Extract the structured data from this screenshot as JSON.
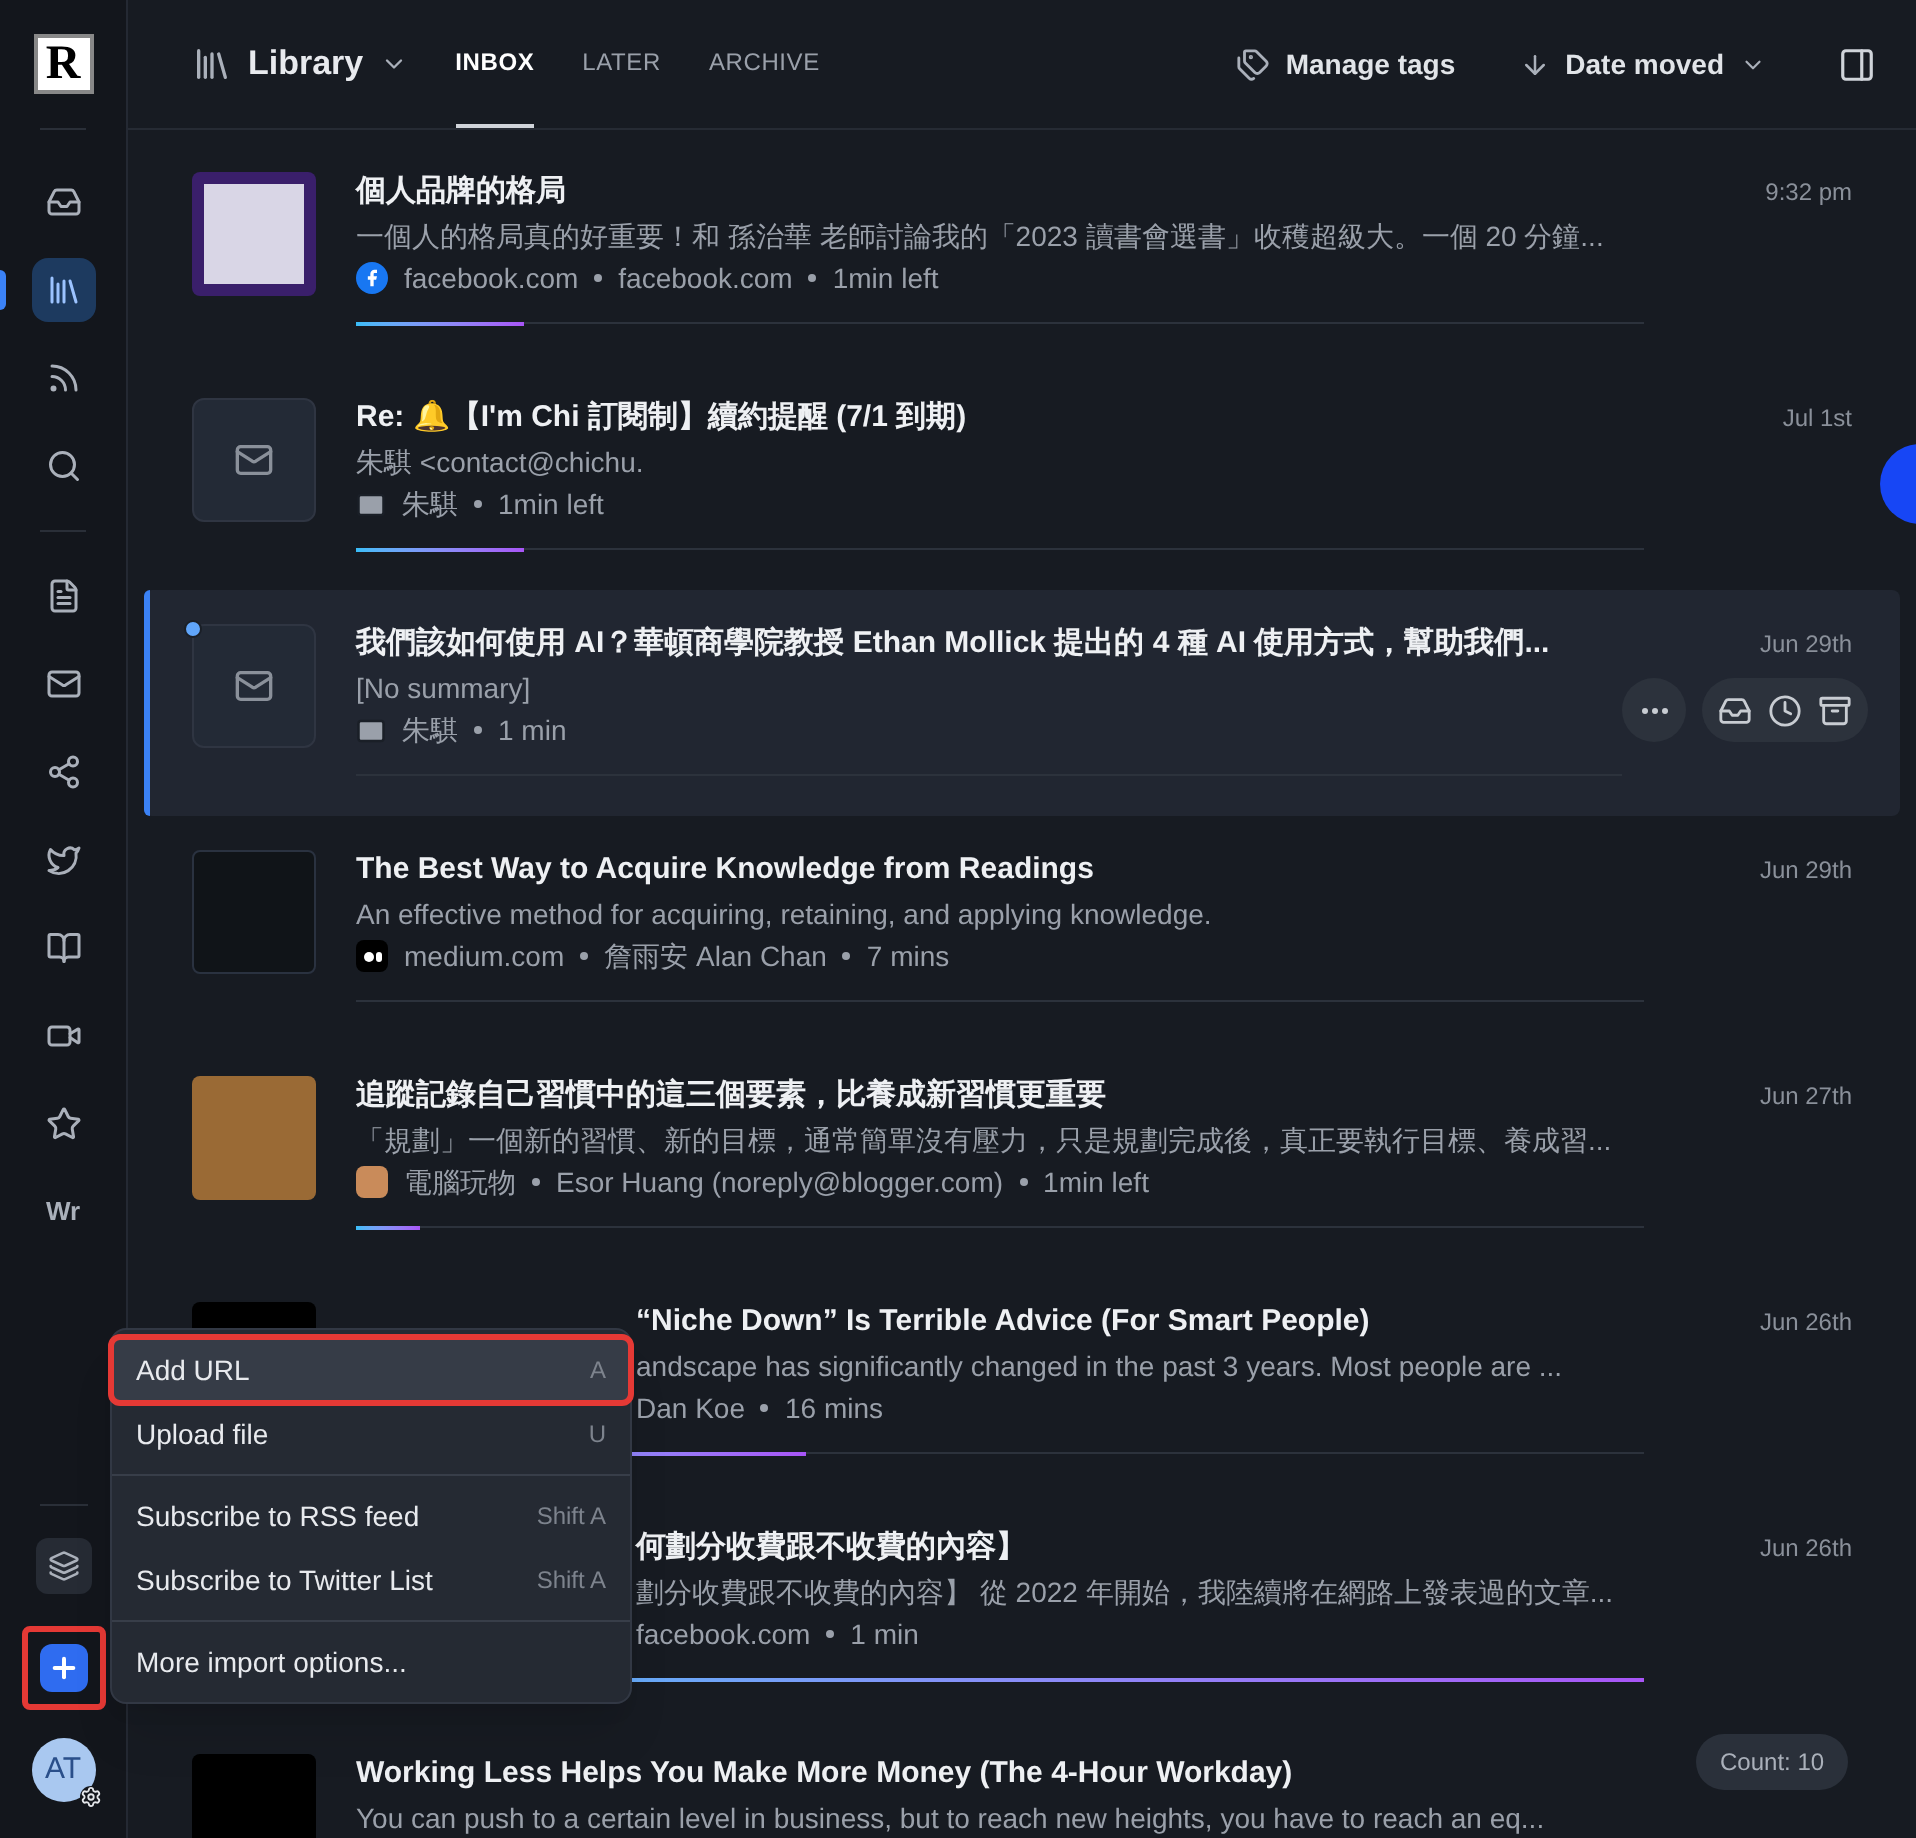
{
  "sidebar": {
    "logo": "R",
    "items": [
      {
        "selected": false
      },
      {
        "selected": true
      },
      {
        "selected": false
      },
      {
        "selected": false
      },
      {
        "selected": false
      },
      {
        "selected": false
      },
      {
        "selected": false
      },
      {
        "selected": false
      },
      {
        "selected": false
      },
      {
        "selected": false
      },
      {
        "selected": false
      },
      {
        "selected": false,
        "label": "Wr"
      }
    ],
    "bottom": [
      {
        "kind": "layers",
        "annotated": false
      },
      {
        "kind": "add",
        "annotated": true
      }
    ],
    "avatar": "AT"
  },
  "header": {
    "title": "Library",
    "tabs": [
      {
        "label": "INBOX",
        "selected": true
      },
      {
        "label": "LATER",
        "selected": false
      },
      {
        "label": "ARCHIVE",
        "selected": false
      }
    ],
    "manage_tags": "Manage tags",
    "sort": "Date moved"
  },
  "rows": [
    {
      "kind": "full",
      "title": "個人品牌的格局",
      "summary": "一個人的格局真的好重要！和 孫治華 老師討論我的「2023 讀書會選書」收穫超級大。一個 20 分鐘...",
      "source_icon": {
        "kind": "facebook"
      },
      "meta": [
        "facebook.com",
        "facebook.com",
        "1min left"
      ],
      "date": "9:32 pm",
      "thumbnail": {
        "kind": "slide"
      },
      "selected": false,
      "unread": false,
      "level": 0.13
    },
    {
      "kind": "full",
      "title": "Re: 🔔【I'm Chi 訂閱制】續約提醒 (7/1 到期)",
      "summary": "朱騏 <contact@chichu.",
      "source_icon": {
        "kind": "mail"
      },
      "meta": [
        "朱騏",
        "1min left"
      ],
      "date": "Jul 1st",
      "thumbnail": {
        "kind": "mail"
      },
      "selected": false,
      "unread": false,
      "level": 0.13
    },
    {
      "kind": "full",
      "title": "我們該如何使用 AI？華頓商學院教授 Ethan Mollick 提出的 4 種 AI 使用方式，幫助我們...",
      "summary": "[No summary]",
      "source_icon": {
        "kind": "mail"
      },
      "meta": [
        "朱騏",
        "1 min"
      ],
      "date": "Jun 29th",
      "thumbnail": {
        "kind": "mail"
      },
      "selected": true,
      "unread": true
    },
    {
      "kind": "full",
      "title": "The Best Way to Acquire Knowledge from Readings",
      "summary": "An effective method for acquiring, retaining, and applying knowledge.",
      "source_icon": {
        "kind": "medium"
      },
      "meta": [
        "medium.com",
        "詹雨安 Alan Chan",
        "7 mins"
      ],
      "date": "Jun 29th",
      "thumbnail": {
        "kind": "diagram"
      },
      "selected": false,
      "unread": false
    },
    {
      "kind": "full",
      "title": "追蹤記錄自己習慣中的這三個要素，比養成新習慣更重要",
      "summary": "「規劃」一個新的習慣、新的目標，通常簡單沒有壓力，只是規劃完成後，真正要執行目標、養成習...",
      "source_icon": {
        "kind": "blog"
      },
      "meta": [
        "電腦玩物",
        "Esor Huang (noreply@blogger.com)",
        "1min left"
      ],
      "date": "Jun 27th",
      "thumbnail": {
        "kind": "photo"
      },
      "selected": false,
      "unread": false,
      "level": 0.05
    },
    {
      "kind": "covered",
      "title": "“Niche Down” Is Terrible Advice (For Smart People)",
      "summary": "andscape has significantly changed in the past 3 years. Most people are ...",
      "meta": [
        "Dan Koe",
        "16 mins"
      ],
      "date": "Jun 26th",
      "thumbnail": {
        "kind": "dark"
      },
      "selected": false,
      "unread": false,
      "level": 0.35
    },
    {
      "kind": "covered",
      "title": "何劃分收費跟不收費的內容】",
      "summary": "劃分收費跟不收費的內容】 從 2022 年開始，我陸續將在網路上發表過的文章...",
      "meta": [
        "facebook.com",
        "1 min"
      ],
      "date": "Jun 26th",
      "selected": false,
      "unread": false,
      "level": 1
    },
    {
      "kind": "full",
      "title": "Working Less Helps You Make More Money (The 4-Hour Workday)",
      "summary": "You can push to a certain level in business, but to reach new heights, you have to reach an eq...",
      "meta": [],
      "thumbnail": {
        "kind": "dark"
      },
      "selected": false,
      "unread": false
    }
  ],
  "count": "Count: 10",
  "menu": {
    "groups": [
      [
        {
          "label": "Add URL",
          "shortcut": "A",
          "selected": true
        },
        {
          "label": "Upload file",
          "shortcut": "U",
          "selected": false
        }
      ],
      [
        {
          "label": "Subscribe to RSS feed",
          "shortcut": "Shift A",
          "selected": false
        },
        {
          "label": "Subscribe to Twitter List",
          "shortcut": "Shift A",
          "selected": false
        }
      ],
      [
        {
          "label": "More import options...",
          "selected": false
        }
      ]
    ]
  }
}
